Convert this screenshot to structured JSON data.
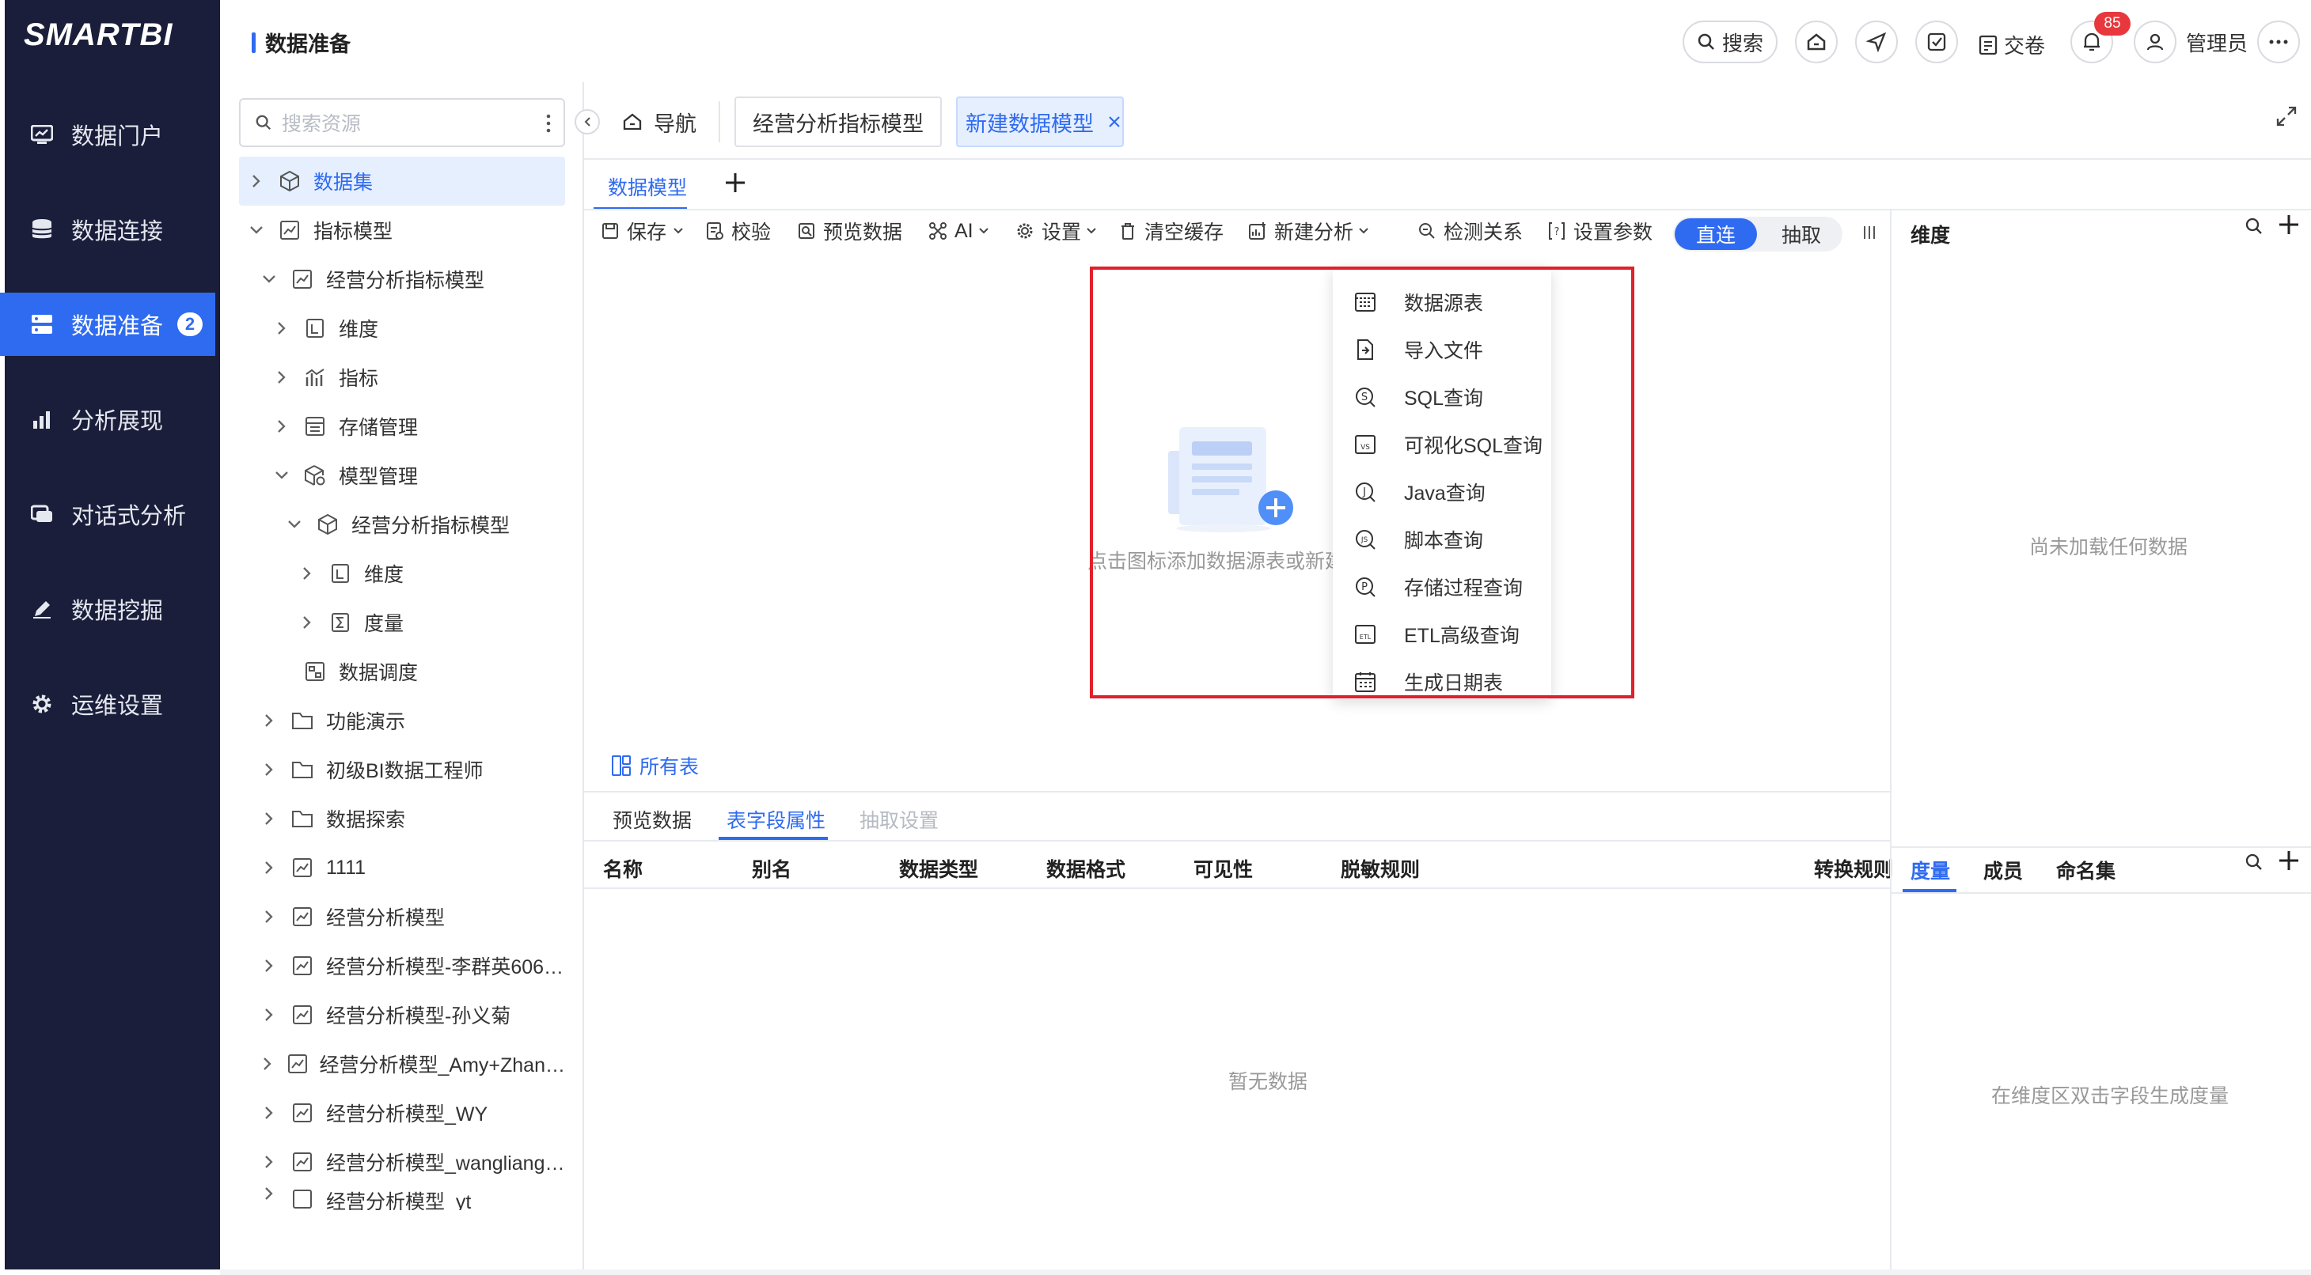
{
  "brand": {
    "logo": "SMARTBI",
    "accent": "#2f6bf0",
    "nav_bg": "#1a1e3a",
    "alert": "#e0202a"
  },
  "sidebar": {
    "items": [
      {
        "label": "数据门户",
        "icon": "dashboard-icon"
      },
      {
        "label": "数据连接",
        "icon": "database-icon"
      },
      {
        "label": "数据准备",
        "icon": "data-prep-icon",
        "badge": "2",
        "active": true
      },
      {
        "label": "分析展现",
        "icon": "bar-chart-icon"
      },
      {
        "label": "对话式分析",
        "icon": "chat-icon"
      },
      {
        "label": "数据挖掘",
        "icon": "pen-icon"
      },
      {
        "label": "运维设置",
        "icon": "gear-icon"
      }
    ]
  },
  "header": {
    "title": "数据准备",
    "search_label": "搜索",
    "submit_label": "交卷",
    "notification_count": "85",
    "user_label": "管理员"
  },
  "tree": {
    "search_placeholder": "搜索资源",
    "nodes": [
      {
        "label": "数据集",
        "icon": "cube-icon"
      },
      {
        "label": "指标模型",
        "icon": "model-icon"
      },
      {
        "label": "经营分析指标模型",
        "icon": "model-icon"
      },
      {
        "label": "维度",
        "icon": "dimension-icon"
      },
      {
        "label": "指标",
        "icon": "metric-icon"
      },
      {
        "label": "存储管理",
        "icon": "storage-icon"
      },
      {
        "label": "模型管理",
        "icon": "cube-gear-icon"
      },
      {
        "label": "经营分析指标模型",
        "icon": "cube-icon"
      },
      {
        "label": "维度",
        "icon": "dimension-icon"
      },
      {
        "label": "度量",
        "icon": "measure-icon"
      },
      {
        "label": "数据调度",
        "icon": "schedule-icon"
      },
      {
        "label": "功能演示",
        "icon": "folder-icon"
      },
      {
        "label": "初级BI数据工程师",
        "icon": "folder-icon"
      },
      {
        "label": "数据探索",
        "icon": "folder-icon"
      },
      {
        "label": "1111",
        "icon": "model-icon"
      },
      {
        "label": "经营分析模型",
        "icon": "model-icon"
      },
      {
        "label": "经营分析模型-李群英606…",
        "icon": "model-icon"
      },
      {
        "label": "经营分析模型-孙义菊",
        "icon": "model-icon"
      },
      {
        "label": "经营分析模型_Amy+Zhan…",
        "icon": "model-icon"
      },
      {
        "label": "经营分析模型_WY",
        "icon": "model-icon"
      },
      {
        "label": "经营分析模型_wangliang…",
        "icon": "model-icon"
      },
      {
        "label": "经营分析模型_yt",
        "icon": "model-icon"
      }
    ]
  },
  "tabs": {
    "nav_label": "导航",
    "tab1": "经营分析指标模型",
    "tab2": "新建数据模型"
  },
  "subtabs": {
    "model": "数据模型"
  },
  "toolbar": {
    "save": "保存",
    "check": "校验",
    "preview": "预览数据",
    "ai": "AI",
    "settings": "设置",
    "clear_cache": "清空缓存",
    "new_analysis": "新建分析",
    "detect_relation": "检测关系",
    "set_params": "设置参数",
    "mode_direct": "直连",
    "mode_extract": "抽取"
  },
  "dropdown": {
    "items": [
      {
        "label": "数据源表",
        "icon": "table-icon"
      },
      {
        "label": "导入文件",
        "icon": "import-file-icon"
      },
      {
        "label": "SQL查询",
        "icon": "sql-icon"
      },
      {
        "label": "可视化SQL查询",
        "icon": "visual-sql-icon"
      },
      {
        "label": "Java查询",
        "icon": "java-icon"
      },
      {
        "label": "脚本查询",
        "icon": "script-icon"
      },
      {
        "label": "存储过程查询",
        "icon": "procedure-icon"
      },
      {
        "label": "ETL高级查询",
        "icon": "etl-icon"
      },
      {
        "label": "生成日期表",
        "icon": "calendar-icon"
      }
    ]
  },
  "canvas": {
    "hint": "点击图标添加数据源表或新建"
  },
  "all_tables": "所有表",
  "bottom": {
    "tabs": [
      "预览数据",
      "表字段属性",
      "抽取设置"
    ],
    "columns": [
      "名称",
      "别名",
      "数据类型",
      "数据格式",
      "可见性",
      "脱敏规则",
      "转换规则"
    ],
    "empty": "暂无数据"
  },
  "right_panel": {
    "dimension_title": "维度",
    "dimension_empty": "尚未加载任何数据",
    "measure_tabs": [
      "度量",
      "成员",
      "命名集"
    ],
    "measure_empty": "在维度区双击字段生成度量"
  }
}
